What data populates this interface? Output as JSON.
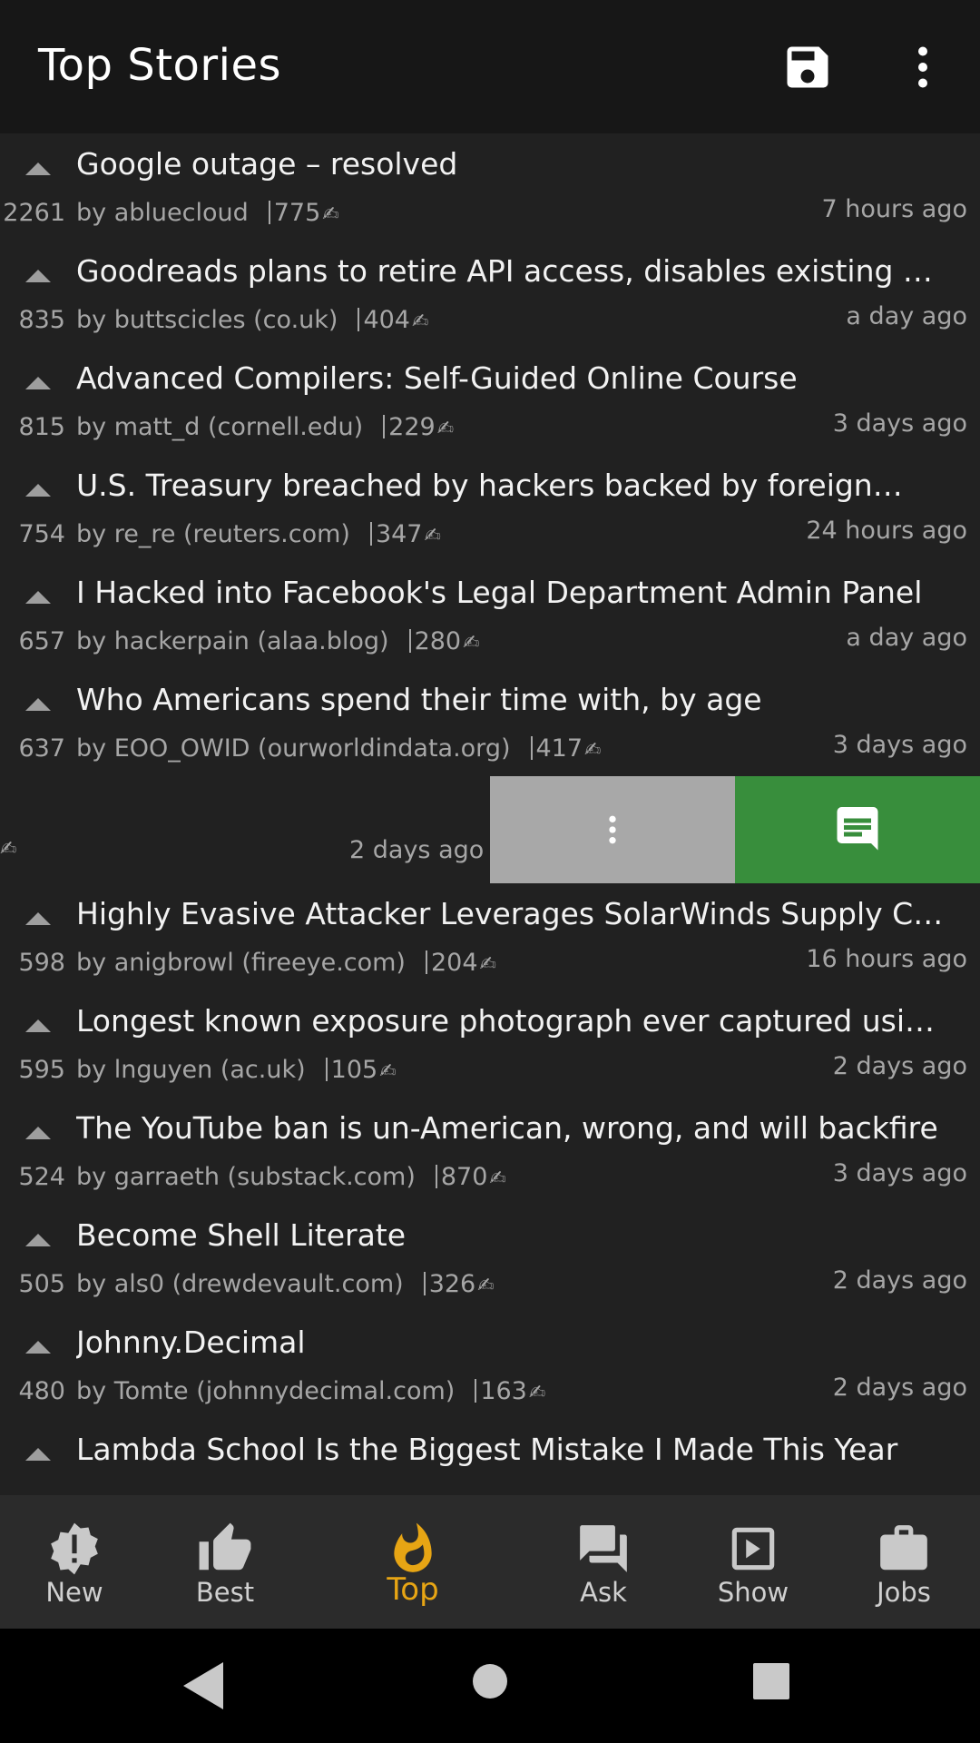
{
  "appbar": {
    "title": "Top Stories",
    "save_icon": "save-icon",
    "more_icon": "more-vert-icon"
  },
  "stories_before": [
    {
      "score": "2261",
      "title": "Google outage – resolved",
      "meta": "by abluecloud",
      "comments": "775",
      "time": "7 hours ago"
    },
    {
      "score": "835",
      "title": "Goodreads plans to retire API access, disables existing API keys",
      "meta": "by buttscicles (co.uk)",
      "comments": "404",
      "time": "a day ago"
    },
    {
      "score": "815",
      "title": "Advanced Compilers: Self-Guided Online Course",
      "meta": "by matt_d (cornell.edu)",
      "comments": "229",
      "time": "3 days ago"
    },
    {
      "score": "754",
      "title": "U.S. Treasury breached by hackers backed by foreign…",
      "meta": "by re_re (reuters.com)",
      "comments": "347",
      "time": "24 hours ago"
    },
    {
      "score": "657",
      "title": "I Hacked into Facebook's Legal Department Admin Panel",
      "meta": "by hackerpain (alaa.blog)",
      "comments": "280",
      "time": "a day ago"
    },
    {
      "score": "637",
      "title": "Who Americans spend their time with, by age",
      "meta": "by EOO_OWID (ourworldindata.org)",
      "comments": "417",
      "time": "3 days ago"
    }
  ],
  "swiped_row": {
    "time": "2 days ago",
    "more_icon": "more-vert-icon",
    "comment_icon": "comment-icon"
  },
  "stories_after": [
    {
      "score": "598",
      "title": "Highly Evasive Attacker Leverages SolarWinds Supply Chain",
      "meta": "by anigbrowl (fireeye.com)",
      "comments": "204",
      "time": "16 hours ago"
    },
    {
      "score": "595",
      "title": "Longest known exposure photograph ever captured using a…",
      "meta": "by lnguyen (ac.uk)",
      "comments": "105",
      "time": "2 days ago"
    },
    {
      "score": "524",
      "title": "The YouTube ban is un-American, wrong, and will backfire",
      "meta": "by garraeth (substack.com)",
      "comments": "870",
      "time": "3 days ago"
    },
    {
      "score": "505",
      "title": "Become Shell Literate",
      "meta": "by als0 (drewdevault.com)",
      "comments": "326",
      "time": "2 days ago"
    },
    {
      "score": "480",
      "title": "Johnny.Decimal",
      "meta": "by Tomte (johnnydecimal.com)",
      "comments": "163",
      "time": "2 days ago"
    },
    {
      "score": "",
      "title": "Lambda School Is the Biggest Mistake I Made This Year",
      "meta": "",
      "comments": "",
      "time": ""
    }
  ],
  "bottomnav": [
    {
      "label": "New",
      "icon": "new-badge-icon"
    },
    {
      "label": "Best",
      "icon": "thumb-up-icon"
    },
    {
      "label": "Top",
      "icon": "flame-icon"
    },
    {
      "label": "Ask",
      "icon": "forum-icon"
    },
    {
      "label": "Show",
      "icon": "play-box-icon"
    },
    {
      "label": "Jobs",
      "icon": "briefcase-icon"
    }
  ],
  "colors": {
    "accent": "#e7a514",
    "swipe_action": "#388e3c",
    "swipe_more": "#a8a8a8"
  }
}
